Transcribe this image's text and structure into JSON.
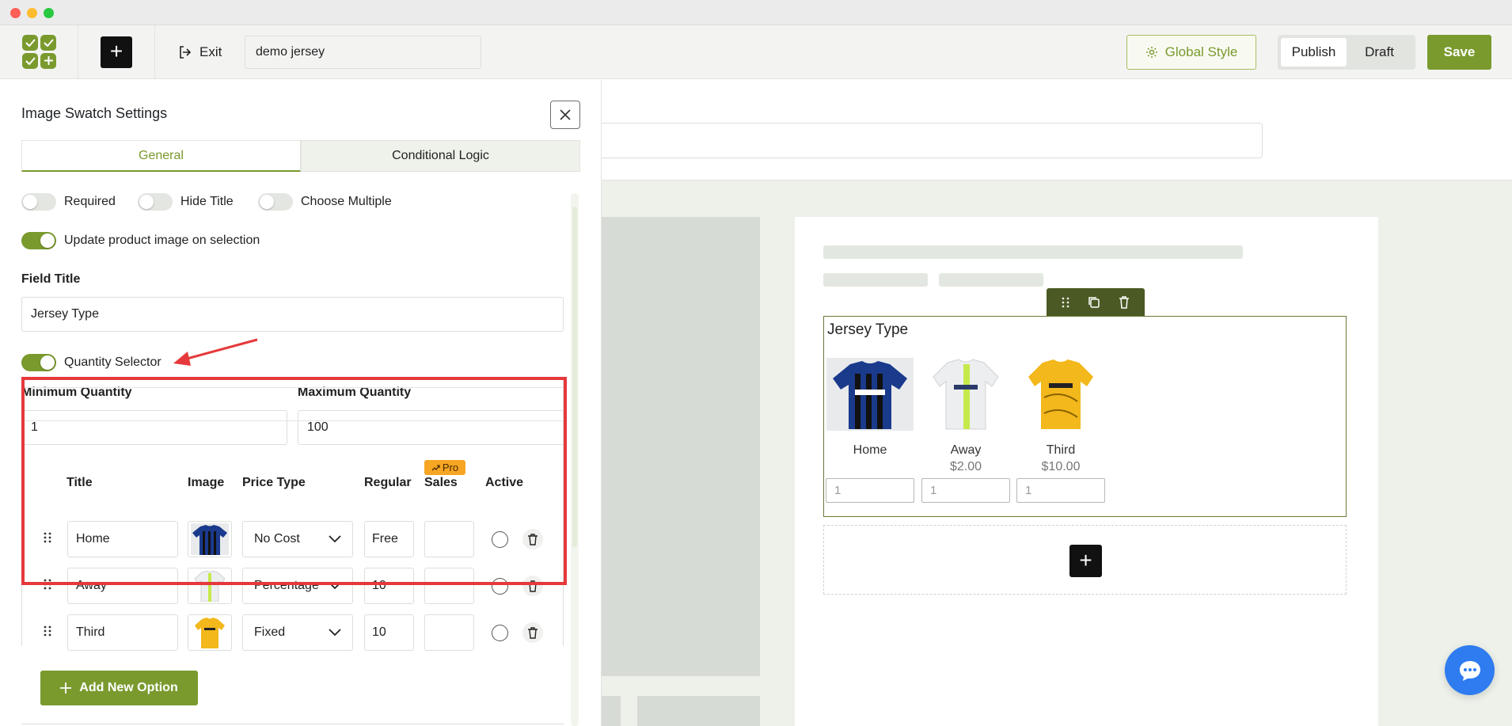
{
  "topbar": {
    "add_label": "+",
    "exit_label": "Exit",
    "doc_name": "demo jersey",
    "global_style_label": "Global Style",
    "publish_label": "Publish",
    "draft_label": "Draft",
    "save_label": "Save"
  },
  "panel": {
    "title": "Image Swatch Settings",
    "tabs": [
      {
        "label": "General",
        "active": true
      },
      {
        "label": "Conditional Logic",
        "active": false
      }
    ],
    "toggles": {
      "required": {
        "label": "Required",
        "on": false
      },
      "hide_title": {
        "label": "Hide Title",
        "on": false
      },
      "choose_multiple": {
        "label": "Choose Multiple",
        "on": false
      },
      "update_image": {
        "label": "Update product image on selection",
        "on": true
      },
      "quantity_selector": {
        "label": "Quantity Selector",
        "on": true
      }
    },
    "field_title_label": "Field Title",
    "field_title_value": "Jersey Type",
    "min_qty_label": "Minimum Quantity",
    "min_qty_value": "1",
    "max_qty_label": "Maximum Quantity",
    "max_qty_value": "100",
    "table": {
      "headers": {
        "title": "Title",
        "image": "Image",
        "price_type": "Price Type",
        "regular": "Regular",
        "sales": "Sales",
        "active": "Active"
      },
      "pro_badge": "Pro",
      "rows": [
        {
          "title": "Home",
          "image": "blue-black-jersey",
          "price_type": "No Cost",
          "regular": "Free",
          "sales": ""
        },
        {
          "title": "Away",
          "image": "white-green-jersey",
          "price_type": "Percentage",
          "regular": "10",
          "sales": ""
        },
        {
          "title": "Third",
          "image": "yellow-jersey",
          "price_type": "Fixed",
          "regular": "10",
          "sales": ""
        }
      ]
    },
    "add_option_label": "Add New Option"
  },
  "preview": {
    "field_title": "Jersey Type",
    "swatches": [
      {
        "name": "Home",
        "price": "",
        "qty": "1"
      },
      {
        "name": "Away",
        "price": "$2.00",
        "qty": "1"
      },
      {
        "name": "Third",
        "price": "$10.00",
        "qty": "1"
      }
    ],
    "add_block_label": "+"
  },
  "colors": {
    "accent": "#7a9a2e",
    "highlight": "#e5393c",
    "pro_badge": "#f6a623",
    "chat": "#2f7bf0"
  }
}
